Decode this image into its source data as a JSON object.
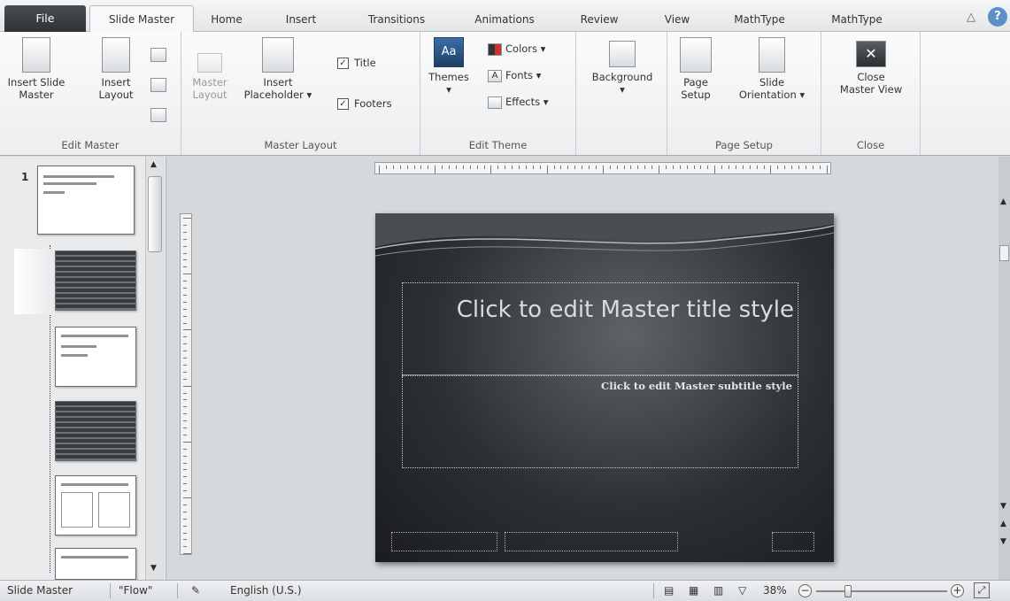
{
  "tabs": {
    "file": "File",
    "slide_master": "Slide Master",
    "home": "Home",
    "insert": "Insert",
    "transitions": "Transitions",
    "animations": "Animations",
    "review": "Review",
    "view": "View",
    "mathtype1": "MathType",
    "mathtype2": "MathType"
  },
  "ribbon": {
    "edit_master": {
      "insert_slide_master_l1": "Insert Slide",
      "insert_slide_master_l2": "Master",
      "insert_layout_l1": "Insert",
      "insert_layout_l2": "Layout",
      "label": "Edit Master"
    },
    "master_layout": {
      "master_layout_l1": "Master",
      "master_layout_l2": "Layout",
      "insert_placeholder_l1": "Insert",
      "insert_placeholder_l2": "Placeholder",
      "title_check": "Title",
      "footers_check": "Footers",
      "label": "Master Layout"
    },
    "edit_theme": {
      "themes": "Themes",
      "colors": "Colors",
      "fonts": "Fonts",
      "effects": "Effects",
      "label": "Edit Theme"
    },
    "background": {
      "background": "Background"
    },
    "page_setup": {
      "page_setup_l1": "Page",
      "page_setup_l2": "Setup",
      "slide_orientation_l1": "Slide",
      "slide_orientation_l2": "Orientation",
      "label": "Page Setup"
    },
    "close": {
      "close_l1": "Close",
      "close_l2": "Master View",
      "label": "Close"
    }
  },
  "thumbnails": {
    "first_number": "1"
  },
  "slide": {
    "title": "Click to edit Master title style",
    "subtitle": "Click to edit Master subtitle style"
  },
  "statusbar": {
    "view_name": "Slide Master",
    "theme_name": "\"Flow\"",
    "language": "English (U.S.)",
    "zoom": "38%",
    "zoom_fraction": 0.23
  }
}
